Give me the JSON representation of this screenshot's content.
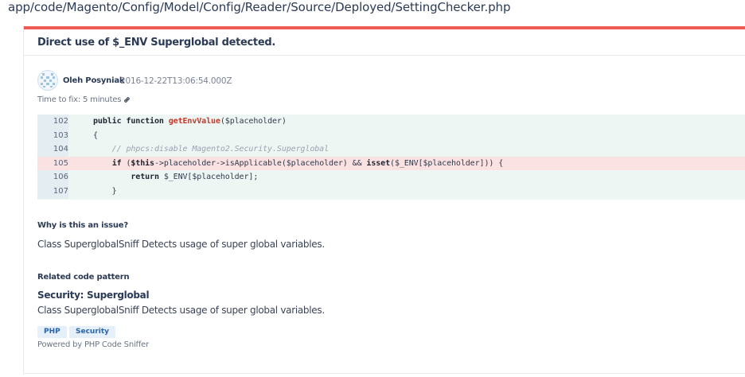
{
  "file_path": "app/code/Magento/Config/Model/Config/Reader/Source/Deployed/SettingChecker.php",
  "issue": {
    "title": "Direct use of $_ENV Superglobal detected.",
    "author": "Oleh Posyniak",
    "date": "2016-12-22T13:06:54.000Z",
    "time_to_fix": "Time to fix: 5 minutes"
  },
  "code": {
    "lines": [
      {
        "no": "102",
        "segments": [
          {
            "t": "public function ",
            "c": "kw"
          },
          {
            "t": "getEnvValue",
            "c": "fn"
          },
          {
            "t": "($placeholder)",
            "c": ""
          }
        ]
      },
      {
        "no": "103",
        "segments": [
          {
            "t": "{",
            "c": ""
          }
        ]
      },
      {
        "no": "104",
        "segments": [
          {
            "t": "    // phpcs:disable Magento2.Security.Superglobal",
            "c": "cm"
          }
        ]
      },
      {
        "no": "105",
        "highlight": true,
        "segments": [
          {
            "t": "    ",
            "c": ""
          },
          {
            "t": "if",
            "c": "kw"
          },
          {
            "t": " (",
            "c": ""
          },
          {
            "t": "$this",
            "c": "kw"
          },
          {
            "t": "->placeholder->isApplicable($placeholder) && ",
            "c": ""
          },
          {
            "t": "isset",
            "c": "kw"
          },
          {
            "t": "($_ENV[$placeholder])) {",
            "c": ""
          }
        ]
      },
      {
        "no": "106",
        "segments": [
          {
            "t": "        ",
            "c": ""
          },
          {
            "t": "return",
            "c": "kw"
          },
          {
            "t": " $_ENV[$placeholder];",
            "c": ""
          }
        ]
      },
      {
        "no": "107",
        "segments": [
          {
            "t": "    }",
            "c": ""
          }
        ]
      }
    ]
  },
  "why": {
    "label": "Why is this an issue?",
    "text": "Class SuperglobalSniff Detects usage of super global variables."
  },
  "related": {
    "label": "Related code pattern",
    "pattern_title": "Security: Superglobal",
    "text": "Class SuperglobalSniff Detects usage of super global variables."
  },
  "tags": [
    "PHP",
    "Security"
  ],
  "powered_by": "Powered by PHP Code Sniffer",
  "icons": {
    "link": "link-icon",
    "avatar": "avatar-identicon"
  },
  "colors": {
    "accent_bar": "#ec5b56",
    "highlight_row": "#fbe2e2",
    "code_bg": "#eef6f4",
    "tag_bg": "#e5f0fa"
  }
}
